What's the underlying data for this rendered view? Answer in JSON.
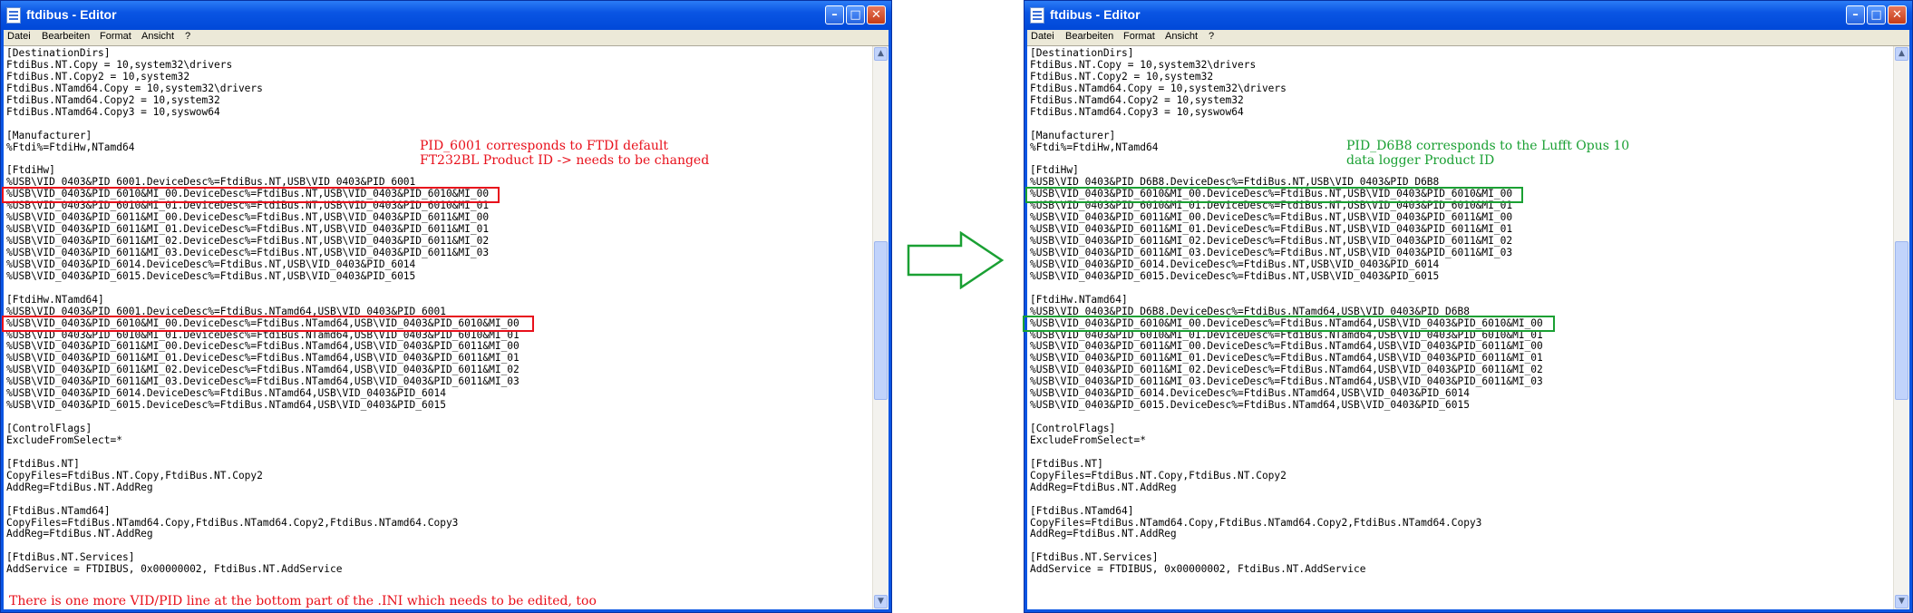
{
  "left_window": {
    "title": "ftdibus - Editor",
    "menu": [
      "Datei",
      "Bearbeiten",
      "Format",
      "Ansicht",
      "?"
    ],
    "lines": [
      "[DestinationDirs]",
      "FtdiBus.NT.Copy = 10,system32\\drivers",
      "FtdiBus.NT.Copy2 = 10,system32",
      "FtdiBus.NTamd64.Copy = 10,system32\\drivers",
      "FtdiBus.NTamd64.Copy2 = 10,system32",
      "FtdiBus.NTamd64.Copy3 = 10,syswow64",
      "",
      "[Manufacturer]",
      "%Ftdi%=FtdiHw,NTamd64",
      "",
      "[FtdiHw]",
      "%USB\\VID_0403&PID_6001.DeviceDesc%=FtdiBus.NT,USB\\VID_0403&PID_6001",
      "%USB\\VID_0403&PID_6010&MI_00.DeviceDesc%=FtdiBus.NT,USB\\VID_0403&PID_6010&MI_00",
      "%USB\\VID_0403&PID_6010&MI_01.DeviceDesc%=FtdiBus.NT,USB\\VID_0403&PID_6010&MI_01",
      "%USB\\VID_0403&PID_6011&MI_00.DeviceDesc%=FtdiBus.NT,USB\\VID_0403&PID_6011&MI_00",
      "%USB\\VID_0403&PID_6011&MI_01.DeviceDesc%=FtdiBus.NT,USB\\VID_0403&PID_6011&MI_01",
      "%USB\\VID_0403&PID_6011&MI_02.DeviceDesc%=FtdiBus.NT,USB\\VID_0403&PID_6011&MI_02",
      "%USB\\VID_0403&PID_6011&MI_03.DeviceDesc%=FtdiBus.NT,USB\\VID_0403&PID_6011&MI_03",
      "%USB\\VID_0403&PID_6014.DeviceDesc%=FtdiBus.NT,USB\\VID_0403&PID_6014",
      "%USB\\VID_0403&PID_6015.DeviceDesc%=FtdiBus.NT,USB\\VID_0403&PID_6015",
      "",
      "[FtdiHw.NTamd64]",
      "%USB\\VID_0403&PID_6001.DeviceDesc%=FtdiBus.NTamd64,USB\\VID_0403&PID_6001",
      "%USB\\VID_0403&PID_6010&MI_00.DeviceDesc%=FtdiBus.NTamd64,USB\\VID_0403&PID_6010&MI_00",
      "%USB\\VID_0403&PID_6010&MI_01.DeviceDesc%=FtdiBus.NTamd64,USB\\VID_0403&PID_6010&MI_01",
      "%USB\\VID_0403&PID_6011&MI_00.DeviceDesc%=FtdiBus.NTamd64,USB\\VID_0403&PID_6011&MI_00",
      "%USB\\VID_0403&PID_6011&MI_01.DeviceDesc%=FtdiBus.NTamd64,USB\\VID_0403&PID_6011&MI_01",
      "%USB\\VID_0403&PID_6011&MI_02.DeviceDesc%=FtdiBus.NTamd64,USB\\VID_0403&PID_6011&MI_02",
      "%USB\\VID_0403&PID_6011&MI_03.DeviceDesc%=FtdiBus.NTamd64,USB\\VID_0403&PID_6011&MI_03",
      "%USB\\VID_0403&PID_6014.DeviceDesc%=FtdiBus.NTamd64,USB\\VID_0403&PID_6014",
      "%USB\\VID_0403&PID_6015.DeviceDesc%=FtdiBus.NTamd64,USB\\VID_0403&PID_6015",
      "",
      "[ControlFlags]",
      "ExcludeFromSelect=*",
      "",
      "[FtdiBus.NT]",
      "CopyFiles=FtdiBus.NT.Copy,FtdiBus.NT.Copy2",
      "AddReg=FtdiBus.NT.AddReg",
      "",
      "[FtdiBus.NTamd64]",
      "CopyFiles=FtdiBus.NTamd64.Copy,FtdiBus.NTamd64.Copy2,FtdiBus.NTamd64.Copy3",
      "AddReg=FtdiBus.NT.AddReg",
      "",
      "[FtdiBus.NT.Services]",
      "AddService = FTDIBUS, 0x00000002, FtdiBus.NT.AddService"
    ],
    "note_top": "PID_6001 corresponds to FTDI default\nFT232BL Product ID -> needs to be changed",
    "note_bottom": "There is one more VID/PID line at the bottom part of the .INI which needs to be edited, too"
  },
  "right_window": {
    "title": "ftdibus - Editor",
    "menu": [
      "Datei",
      "Bearbeiten",
      "Format",
      "Ansicht",
      "?"
    ],
    "lines": [
      "[DestinationDirs]",
      "FtdiBus.NT.Copy = 10,system32\\drivers",
      "FtdiBus.NT.Copy2 = 10,system32",
      "FtdiBus.NTamd64.Copy = 10,system32\\drivers",
      "FtdiBus.NTamd64.Copy2 = 10,system32",
      "FtdiBus.NTamd64.Copy3 = 10,syswow64",
      "",
      "[Manufacturer]",
      "%Ftdi%=FtdiHw,NTamd64",
      "",
      "[FtdiHw]",
      "%USB\\VID_0403&PID_D6B8.DeviceDesc%=FtdiBus.NT,USB\\VID_0403&PID_D6B8",
      "%USB\\VID_0403&PID_6010&MI_00.DeviceDesc%=FtdiBus.NT,USB\\VID_0403&PID_6010&MI_00",
      "%USB\\VID_0403&PID_6010&MI_01.DeviceDesc%=FtdiBus.NT,USB\\VID_0403&PID_6010&MI_01",
      "%USB\\VID_0403&PID_6011&MI_00.DeviceDesc%=FtdiBus.NT,USB\\VID_0403&PID_6011&MI_00",
      "%USB\\VID_0403&PID_6011&MI_01.DeviceDesc%=FtdiBus.NT,USB\\VID_0403&PID_6011&MI_01",
      "%USB\\VID_0403&PID_6011&MI_02.DeviceDesc%=FtdiBus.NT,USB\\VID_0403&PID_6011&MI_02",
      "%USB\\VID_0403&PID_6011&MI_03.DeviceDesc%=FtdiBus.NT,USB\\VID_0403&PID_6011&MI_03",
      "%USB\\VID_0403&PID_6014.DeviceDesc%=FtdiBus.NT,USB\\VID_0403&PID_6014",
      "%USB\\VID_0403&PID_6015.DeviceDesc%=FtdiBus.NT,USB\\VID_0403&PID_6015",
      "",
      "[FtdiHw.NTamd64]",
      "%USB\\VID_0403&PID_D6B8.DeviceDesc%=FtdiBus.NTamd64,USB\\VID_0403&PID_D6B8",
      "%USB\\VID_0403&PID_6010&MI_00.DeviceDesc%=FtdiBus.NTamd64,USB\\VID_0403&PID_6010&MI_00",
      "%USB\\VID_0403&PID_6010&MI_01.DeviceDesc%=FtdiBus.NTamd64,USB\\VID_0403&PID_6010&MI_01",
      "%USB\\VID_0403&PID_6011&MI_00.DeviceDesc%=FtdiBus.NTamd64,USB\\VID_0403&PID_6011&MI_00",
      "%USB\\VID_0403&PID_6011&MI_01.DeviceDesc%=FtdiBus.NTamd64,USB\\VID_0403&PID_6011&MI_01",
      "%USB\\VID_0403&PID_6011&MI_02.DeviceDesc%=FtdiBus.NTamd64,USB\\VID_0403&PID_6011&MI_02",
      "%USB\\VID_0403&PID_6011&MI_03.DeviceDesc%=FtdiBus.NTamd64,USB\\VID_0403&PID_6011&MI_03",
      "%USB\\VID_0403&PID_6014.DeviceDesc%=FtdiBus.NTamd64,USB\\VID_0403&PID_6014",
      "%USB\\VID_0403&PID_6015.DeviceDesc%=FtdiBus.NTamd64,USB\\VID_0403&PID_6015",
      "",
      "[ControlFlags]",
      "ExcludeFromSelect=*",
      "",
      "[FtdiBus.NT]",
      "CopyFiles=FtdiBus.NT.Copy,FtdiBus.NT.Copy2",
      "AddReg=FtdiBus.NT.AddReg",
      "",
      "[FtdiBus.NTamd64]",
      "CopyFiles=FtdiBus.NTamd64.Copy,FtdiBus.NTamd64.Copy2,FtdiBus.NTamd64.Copy3",
      "AddReg=FtdiBus.NT.AddReg",
      "",
      "[FtdiBus.NT.Services]",
      "AddService = FTDIBUS, 0x00000002, FtdiBus.NT.AddService"
    ],
    "note_top": "PID_D6B8 corresponds to the Lufft Opus 10\ndata logger Product ID"
  },
  "icons": {
    "minimize": "minimize-icon",
    "maximize": "maximize-icon",
    "close": "close-icon",
    "arrow": "right-arrow-icon"
  },
  "colors": {
    "titlebar": "#0a55e3",
    "highlight_red": "#e8101b",
    "highlight_green": "#1aa033"
  }
}
